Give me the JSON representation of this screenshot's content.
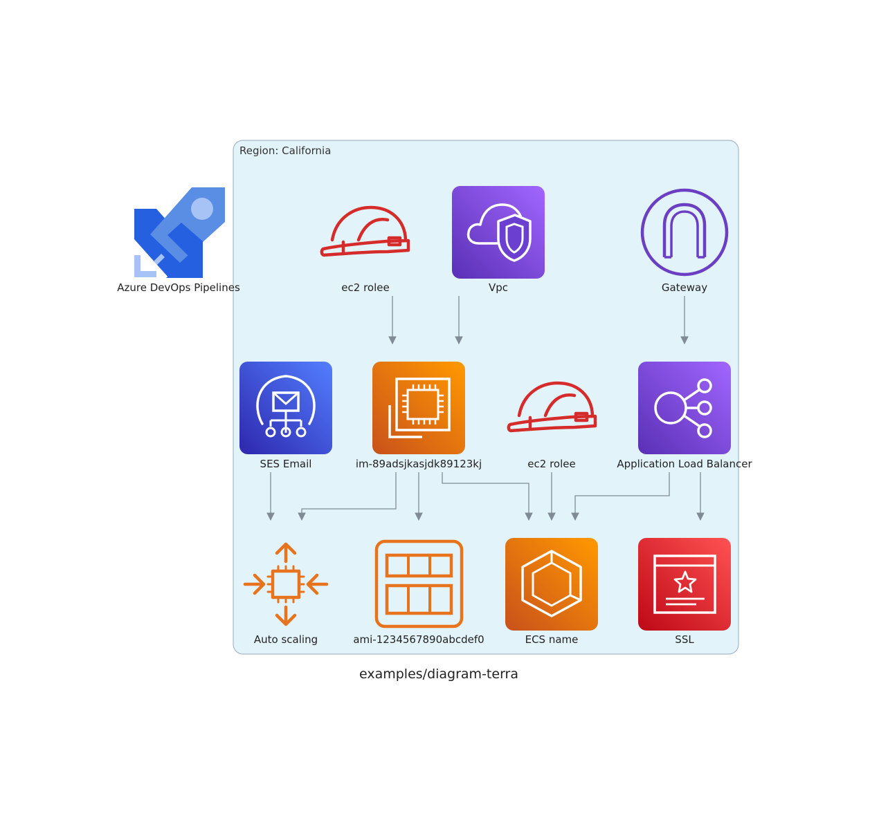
{
  "caption": "examples/diagram-terra",
  "region": {
    "label": "Region: California"
  },
  "colors": {
    "region_fill": "#e3f3fa",
    "region_border": "#a7b8c3",
    "edge": "#7f8c95",
    "iam_red": "#d62b2b",
    "purple": "#8c4fff",
    "orange": "#e7731c",
    "ses_blue": "#3b48cc",
    "ssl_red": "#dd344c",
    "azure_blue": "#2560e0"
  },
  "nodes": {
    "azure": {
      "label": "Azure DevOps Pipelines",
      "icon": "azure-pipelines-icon"
    },
    "ec2_role_top": {
      "label": "ec2 rolee",
      "icon": "iam-role-hardhat-icon"
    },
    "vpc": {
      "label": "Vpc",
      "icon": "vpc-cloud-shield-icon"
    },
    "gateway": {
      "label": "Gateway",
      "icon": "internet-gateway-icon"
    },
    "ses": {
      "label": "SES Email",
      "icon": "ses-email-icon"
    },
    "ec2": {
      "label": "im-89adsjkasjdk89123kj",
      "icon": "ec2-chip-icon"
    },
    "ec2_role_mid": {
      "label": "ec2 rolee",
      "icon": "iam-role-hardhat-icon"
    },
    "alb": {
      "label": "Application Load Balancer",
      "icon": "load-balancer-icon"
    },
    "autoscaling": {
      "label": "Auto scaling",
      "icon": "auto-scaling-icon"
    },
    "ami": {
      "label": "ami-1234567890abcdef0",
      "icon": "ami-grid-icon"
    },
    "ecs": {
      "label": "ECS name",
      "icon": "ecs-hexagon-icon"
    },
    "ssl": {
      "label": "SSL",
      "icon": "certificate-star-icon"
    }
  },
  "edges": [
    {
      "from": "ec2_role_top",
      "to": "ec2"
    },
    {
      "from": "vpc",
      "to": "ec2"
    },
    {
      "from": "gateway",
      "to": "alb"
    },
    {
      "from": "ses",
      "to": "autoscaling"
    },
    {
      "from": "ec2",
      "to": "autoscaling"
    },
    {
      "from": "ec2",
      "to": "ami"
    },
    {
      "from": "ec2",
      "to": "ecs"
    },
    {
      "from": "ec2_role_mid",
      "to": "ecs"
    },
    {
      "from": "alb",
      "to": "ecs"
    },
    {
      "from": "alb",
      "to": "ssl"
    }
  ]
}
